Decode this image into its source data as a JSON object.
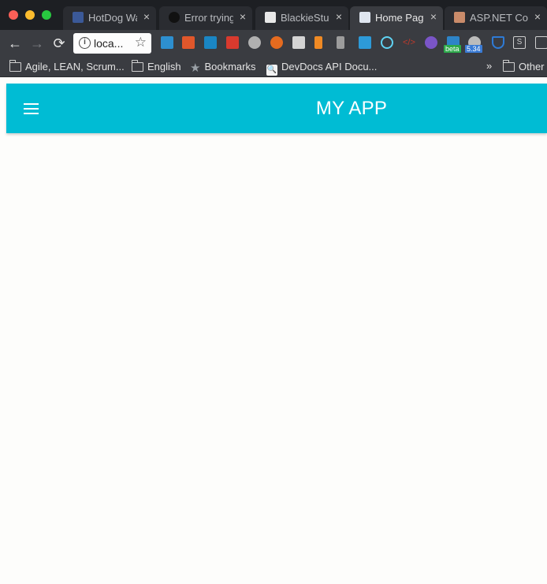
{
  "browser": {
    "tabs": [
      {
        "title": "HotDog Wat",
        "favicon": "facebook-icon",
        "color": "#3b5998",
        "active": false
      },
      {
        "title": "Error trying",
        "favicon": "github-icon",
        "color": "#111111",
        "active": false
      },
      {
        "title": "BlackieStud",
        "favicon": "blackiestudio-icon",
        "color": "#e8e8e8",
        "active": false
      },
      {
        "title": "Home Page",
        "favicon": "page-icon",
        "color": "#dfe6f0",
        "active": true
      },
      {
        "title": "ASP.NET Co",
        "favicon": "avatar-icon",
        "color": "#c98b6a",
        "active": false
      }
    ],
    "close_glyph": "×",
    "address": {
      "url": "loca..."
    },
    "nav": {
      "back": "←",
      "forward": "→",
      "reload": "⟳"
    },
    "extensions": [
      {
        "name": "instapaper-icon",
        "color": "#2d8fcf"
      },
      {
        "name": "book-icon",
        "color": "#e1572b"
      },
      {
        "name": "trello-icon",
        "color": "#1a86c4"
      },
      {
        "name": "bug-icon",
        "color": "#d83a2e"
      },
      {
        "name": "stopwatch-icon",
        "color": "#b0b0b0"
      },
      {
        "name": "firefox-icon",
        "color": "#e56b1f"
      },
      {
        "name": "printer-icon",
        "color": "#d4d4d4"
      },
      {
        "name": "ruler-icon",
        "color": "#f08a24"
      },
      {
        "name": "bars-icon",
        "color": "#9c9c9c"
      },
      {
        "name": "css3-icon",
        "color": "#2d9ad8"
      },
      {
        "name": "react-icon",
        "color": "#5fd3f3"
      },
      {
        "name": "code-icon",
        "color": "#c0392b"
      },
      {
        "name": "gauge-icon",
        "color": "#7a55c7"
      },
      {
        "name": "folder-beta-icon",
        "color": "#2d84c8"
      },
      {
        "name": "avatar-ext-icon",
        "color": "#bbbbbb"
      },
      {
        "name": "shield-icon",
        "color": "#2e7bd6"
      },
      {
        "name": "bracket-s-icon",
        "color": "#cfcfcf"
      },
      {
        "name": "window-icon",
        "color": "#cfcfcf"
      }
    ],
    "badges": {
      "beta": "beta",
      "version": "5.34"
    },
    "bookmarks": [
      {
        "label": "Agile, LEAN, Scrum...",
        "icon": "folder-icon"
      },
      {
        "label": "English",
        "icon": "folder-icon"
      },
      {
        "label": "Bookmarks",
        "icon": "star-icon"
      },
      {
        "label": "DevDocs API Docu...",
        "icon": "devdocs-icon"
      }
    ],
    "overflow": "»",
    "other_bookmarks": "Other"
  },
  "app": {
    "title": "MY APP",
    "accent": "#00bcd4",
    "menu_icon": "hamburger-menu-icon"
  }
}
